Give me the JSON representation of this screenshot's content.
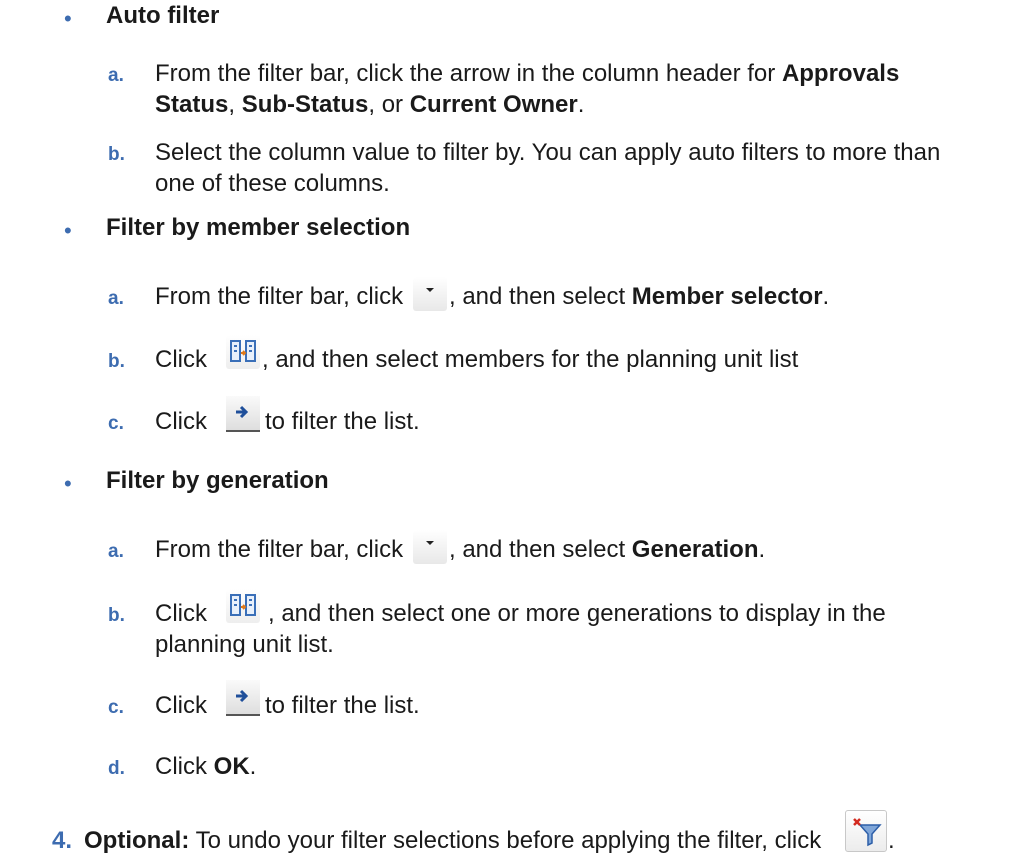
{
  "auto_filter": {
    "heading": "Auto filter",
    "a_marker": "a.",
    "a_text_1": "From the filter bar, click the arrow in the column header for ",
    "a_bold_1": "Approvals",
    "a_bold_2": "Status",
    "a_text_2": ", ",
    "a_bold_3": "Sub-Status",
    "a_text_3": ", or ",
    "a_bold_4": "Current Owner",
    "a_text_4": ".",
    "b_marker": "b.",
    "b_text_1": "Select the column value to filter by. You can apply auto filters to more than",
    "b_text_2": "one of these columns."
  },
  "member_selection": {
    "heading": "Filter by member selection",
    "a_marker": "a.",
    "a_text_1": "From the filter bar, click",
    "a_text_2": ", and then select ",
    "a_bold": "Member selector",
    "a_text_3": ".",
    "b_marker": "b.",
    "b_text_1": "Click",
    "b_text_2": ", and then select members for the planning unit list",
    "c_marker": "c.",
    "c_text_1": "Click",
    "c_text_2": "to filter the list."
  },
  "generation": {
    "heading": "Filter by generation",
    "a_marker": "a.",
    "a_text_1": "From the filter bar, click",
    "a_text_2": ", and then select ",
    "a_bold": "Generation",
    "a_text_3": ".",
    "b_marker": "b.",
    "b_text_1": "Click",
    "b_text_2": ", and then select one or more generations to display in the",
    "b_text_3": "planning unit list.",
    "c_marker": "c.",
    "c_text_1": "Click",
    "c_text_2": "to filter the list.",
    "d_marker": "d.",
    "d_text_1": "Click ",
    "d_bold": "OK",
    "d_text_2": "."
  },
  "step4": {
    "number": "4.",
    "bold": "Optional:",
    "text": " To undo your filter selections before applying the filter, click",
    "end": "."
  },
  "bullet_glyph": "•",
  "icons": {
    "dropdown": "dropdown-arrow-icon",
    "member_selector": "member-selector-icon",
    "go": "right-arrow-icon",
    "clear_filter": "clear-filter-icon"
  }
}
